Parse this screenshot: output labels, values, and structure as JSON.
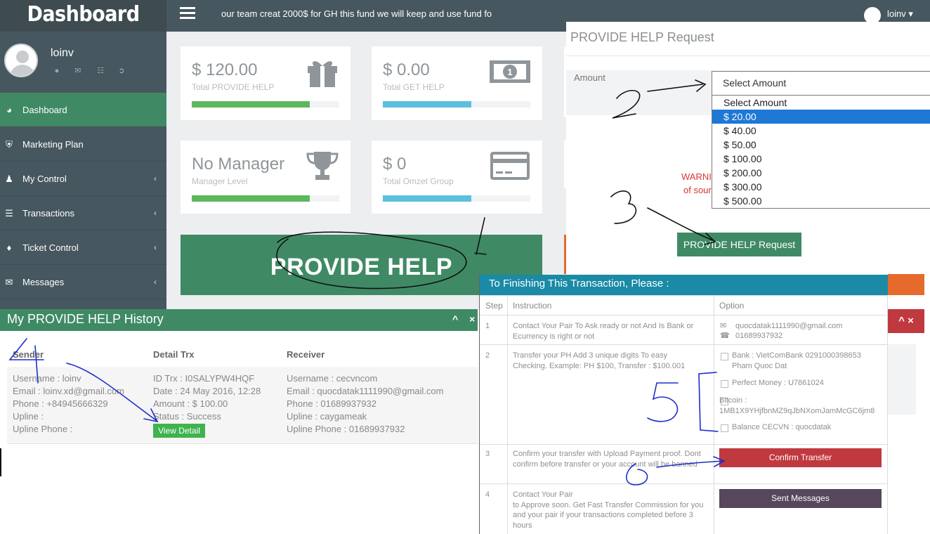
{
  "brand": "Dashboard",
  "user": {
    "name": "loinv"
  },
  "topbar": {
    "announcement": "our team creat 2000$ for GH this fund we will keep and use fund fo",
    "username": "loinv"
  },
  "sidebar": {
    "items": [
      {
        "label": "Dashboard",
        "icon": "dashboard-icon",
        "active": true
      },
      {
        "label": "Marketing Plan",
        "icon": "shield-icon"
      },
      {
        "label": "My Control",
        "icon": "user-icon",
        "chevron": "‹"
      },
      {
        "label": "Transactions",
        "icon": "list-icon",
        "chevron": "‹"
      },
      {
        "label": "Ticket Control",
        "icon": "ticket-icon",
        "chevron": "‹"
      },
      {
        "label": "Messages",
        "icon": "envelope-icon",
        "chevron": "‹"
      }
    ]
  },
  "stats": [
    {
      "value": "$ 120.00",
      "label": "Total PROVIDE HELP",
      "progress": 0.8,
      "color": "#5cb85c",
      "icon": "gift-icon"
    },
    {
      "value": "$ 0.00",
      "label": "Total GET HELP",
      "progress": 0.6,
      "color": "#5bc0de",
      "icon": "money-icon"
    },
    {
      "value": "No Manager",
      "label": "Manager Level",
      "progress": 0.8,
      "color": "#5cb85c",
      "icon": "trophy-icon"
    },
    {
      "value": "$ 0",
      "label": "Total Omzet Group",
      "progress": 0.6,
      "color": "#5bc0de",
      "icon": "credit-card-icon"
    }
  ],
  "provide_help_button": "PROVIDE HELP",
  "request_modal": {
    "title": "PROVIDE HELP Request",
    "amount_label": "Amount",
    "select_value": "Select Amount",
    "options": [
      "Select Amount",
      "$ 20.00",
      "$ 40.00",
      "$ 50.00",
      "$ 100.00",
      "$ 200.00",
      "$ 300.00",
      "$ 500.00"
    ],
    "highlighted_option": "$ 20.00",
    "warning_line1": "WARNI",
    "warning_line2": "of sour",
    "submit_label": "PROVIDE HELP Request"
  },
  "history": {
    "title": "My PROVIDE HELP History",
    "controls": "^ ×",
    "columns": [
      "Sender",
      "Detail Trx",
      "Receiver"
    ],
    "row": {
      "sender": [
        "Username : loinv",
        "Email : loinv.xd@gmail.com",
        "Phone : +84945666329",
        "Upline :",
        "Upline Phone :"
      ],
      "detail": [
        "ID Trx : I0SALYPW4HQF",
        "Date : 24 May 2016, 12:28",
        "Amount : $ 100.00",
        "Status : Success"
      ],
      "receiver": [
        "Username : cecvncom",
        "Email : quocdatak1111990@gmail.com",
        "Phone : 01689937932",
        "Upline : caygameak",
        "Upline Phone : 01689937932"
      ],
      "view_detail": "View Detail"
    }
  },
  "transaction": {
    "title": "To Finishing This Transaction, Please :",
    "columns": [
      "Step",
      "Instruction",
      "Option"
    ],
    "steps": [
      {
        "step": "1",
        "instruction": "Contact Your Pair To Ask ready or not And Is Bank or Ecurrency is right or not",
        "email": "quocdatak1111990@gmail.com",
        "phone": "01689937932"
      },
      {
        "step": "2",
        "instruction": "Transfer your PH Add 3 unique digits To easy Checking. Example: PH $100, Transfer : $100.001",
        "options": [
          "Bank : VietComBank 0291000398653 Pham Quoc Dat",
          "Perfect Money : U7861024",
          "Bitcoin : 1MB1X9YHjfbnMZ9qJbNXomJamMcGC6jm8",
          "Balance CECVN : quocdatak"
        ]
      },
      {
        "step": "3",
        "instruction": "Confirm your transfer with Upload Payment proof. Dont confirm before transfer or your account will be banned",
        "button": "Confirm Transfer"
      },
      {
        "step": "4",
        "instruction_line1": "Contact Your Pair",
        "instruction_line2": "to Approve soon. Get Fast Transfer Commission for you and your pair if your transactions completed before 3 hours",
        "button": "Sent Messages"
      }
    ]
  },
  "annotations": [
    "1",
    "2",
    "3",
    "4",
    "5",
    "6"
  ]
}
